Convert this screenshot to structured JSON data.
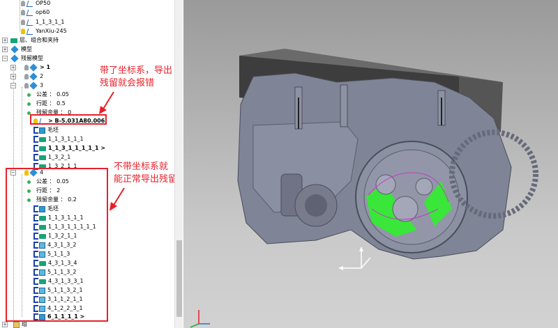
{
  "tree": {
    "rows": [
      {
        "label": "OP50"
      },
      {
        "label": "op60"
      },
      {
        "label": "1_1_3_1_1"
      },
      {
        "label": "YanXiu-245"
      },
      {
        "label": "层、组合和夹持"
      },
      {
        "label": "模型"
      },
      {
        "label": "残留模型"
      },
      {
        "label": "> 1"
      },
      {
        "label": "2"
      },
      {
        "label": "3"
      },
      {
        "label": "公差 ： 0.05"
      },
      {
        "label": "行距 ： 0.5"
      },
      {
        "label": "残留余量 ： 0"
      },
      {
        "label": "> B-5.031A80.006"
      },
      {
        "label": "毛坯"
      },
      {
        "label": "1_1_3_1_1_1"
      },
      {
        "label": "1_1_3_1_1_1_1_1 >"
      },
      {
        "label": "1_3_2_1"
      },
      {
        "label": "1_3_2_1_1"
      },
      {
        "label": "4"
      },
      {
        "label": "公差 ： 0.05"
      },
      {
        "label": "行距 ： 2"
      },
      {
        "label": "残留余量 ： 0.2"
      },
      {
        "label": "毛坯"
      },
      {
        "label": "1_1_3_1_1_1"
      },
      {
        "label": "1_1_3_1_1_1_1_1"
      },
      {
        "label": "1_3_2_1_1"
      },
      {
        "label": "4_3_1_3_2"
      },
      {
        "label": "5_1_1_3"
      },
      {
        "label": "4_3_1_3_4"
      },
      {
        "label": "5_1_1_3_2"
      },
      {
        "label": "4_3_1_3_3_1"
      },
      {
        "label": "5_1_1_3_2_1"
      },
      {
        "label": "3_1_1_2_1_1"
      },
      {
        "label": "4_1_2_2_3_1"
      },
      {
        "label": "6_1_1_1_1 >"
      },
      {
        "label": "组"
      }
    ]
  },
  "annotations": {
    "top_note_line1": "带了坐标系，导出",
    "top_note_line2": "残留就会报错",
    "bottom_note_line1": "不带坐标系就",
    "bottom_note_line2": "能正常导出残留"
  },
  "colors": {
    "annotation_red": "#e8202a",
    "model_body": "#7f8496",
    "residual_green": "#39e639"
  }
}
